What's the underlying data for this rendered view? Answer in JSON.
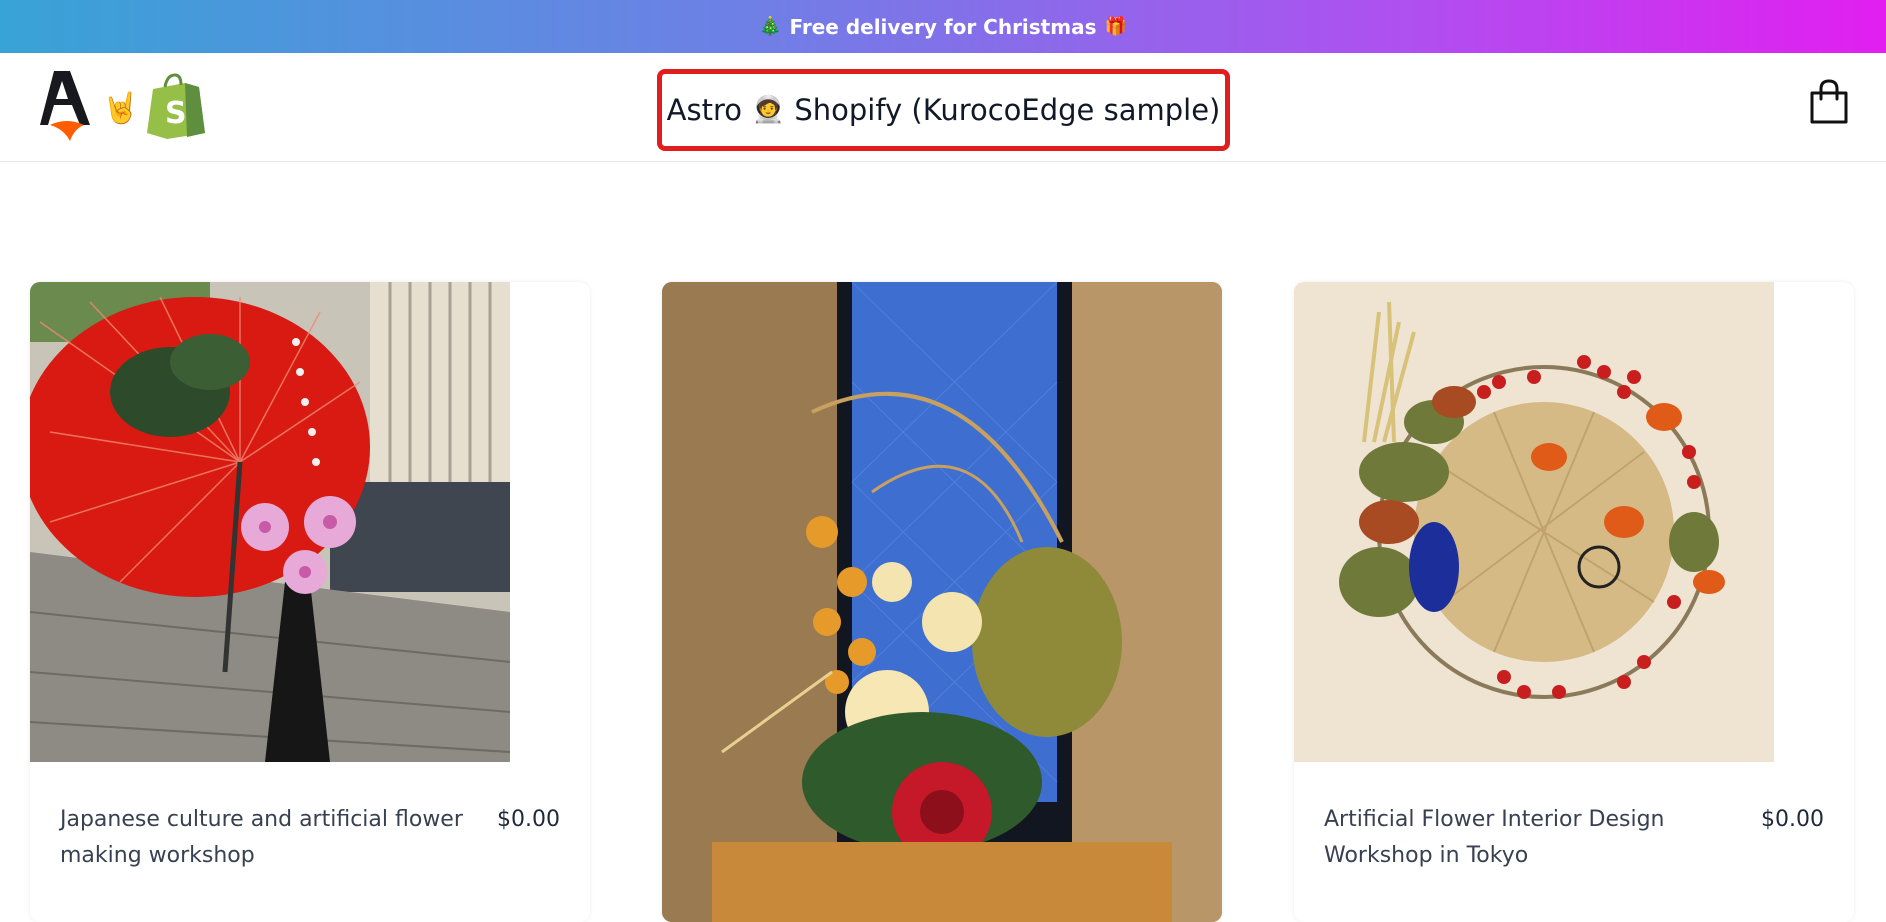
{
  "banner": {
    "text": "Free delivery for Christmas",
    "left_emoji": "🎄",
    "right_emoji": "🎁"
  },
  "header": {
    "rock_hand_emoji": "🤘",
    "title_part1": "Astro",
    "title_emoji": "🧑‍🚀",
    "title_part2": "Shopify (KurocoEdge sample)",
    "cart_icon": "shopping-bag-icon"
  },
  "products": [
    {
      "name": "Japanese culture and artificial flower making workshop",
      "price": "$0.00",
      "image": "red-parasol-ikebana"
    },
    {
      "name": "",
      "price": "",
      "image": "window-flower-arrangement"
    },
    {
      "name": "Artificial Flower Interior Design Workshop in Tokyo",
      "price": "$0.00",
      "image": "berry-wreath"
    }
  ],
  "colors": {
    "banner_start": "#38a3d6",
    "banner_end": "#e21ef0",
    "highlight_border": "#e01e1e"
  }
}
